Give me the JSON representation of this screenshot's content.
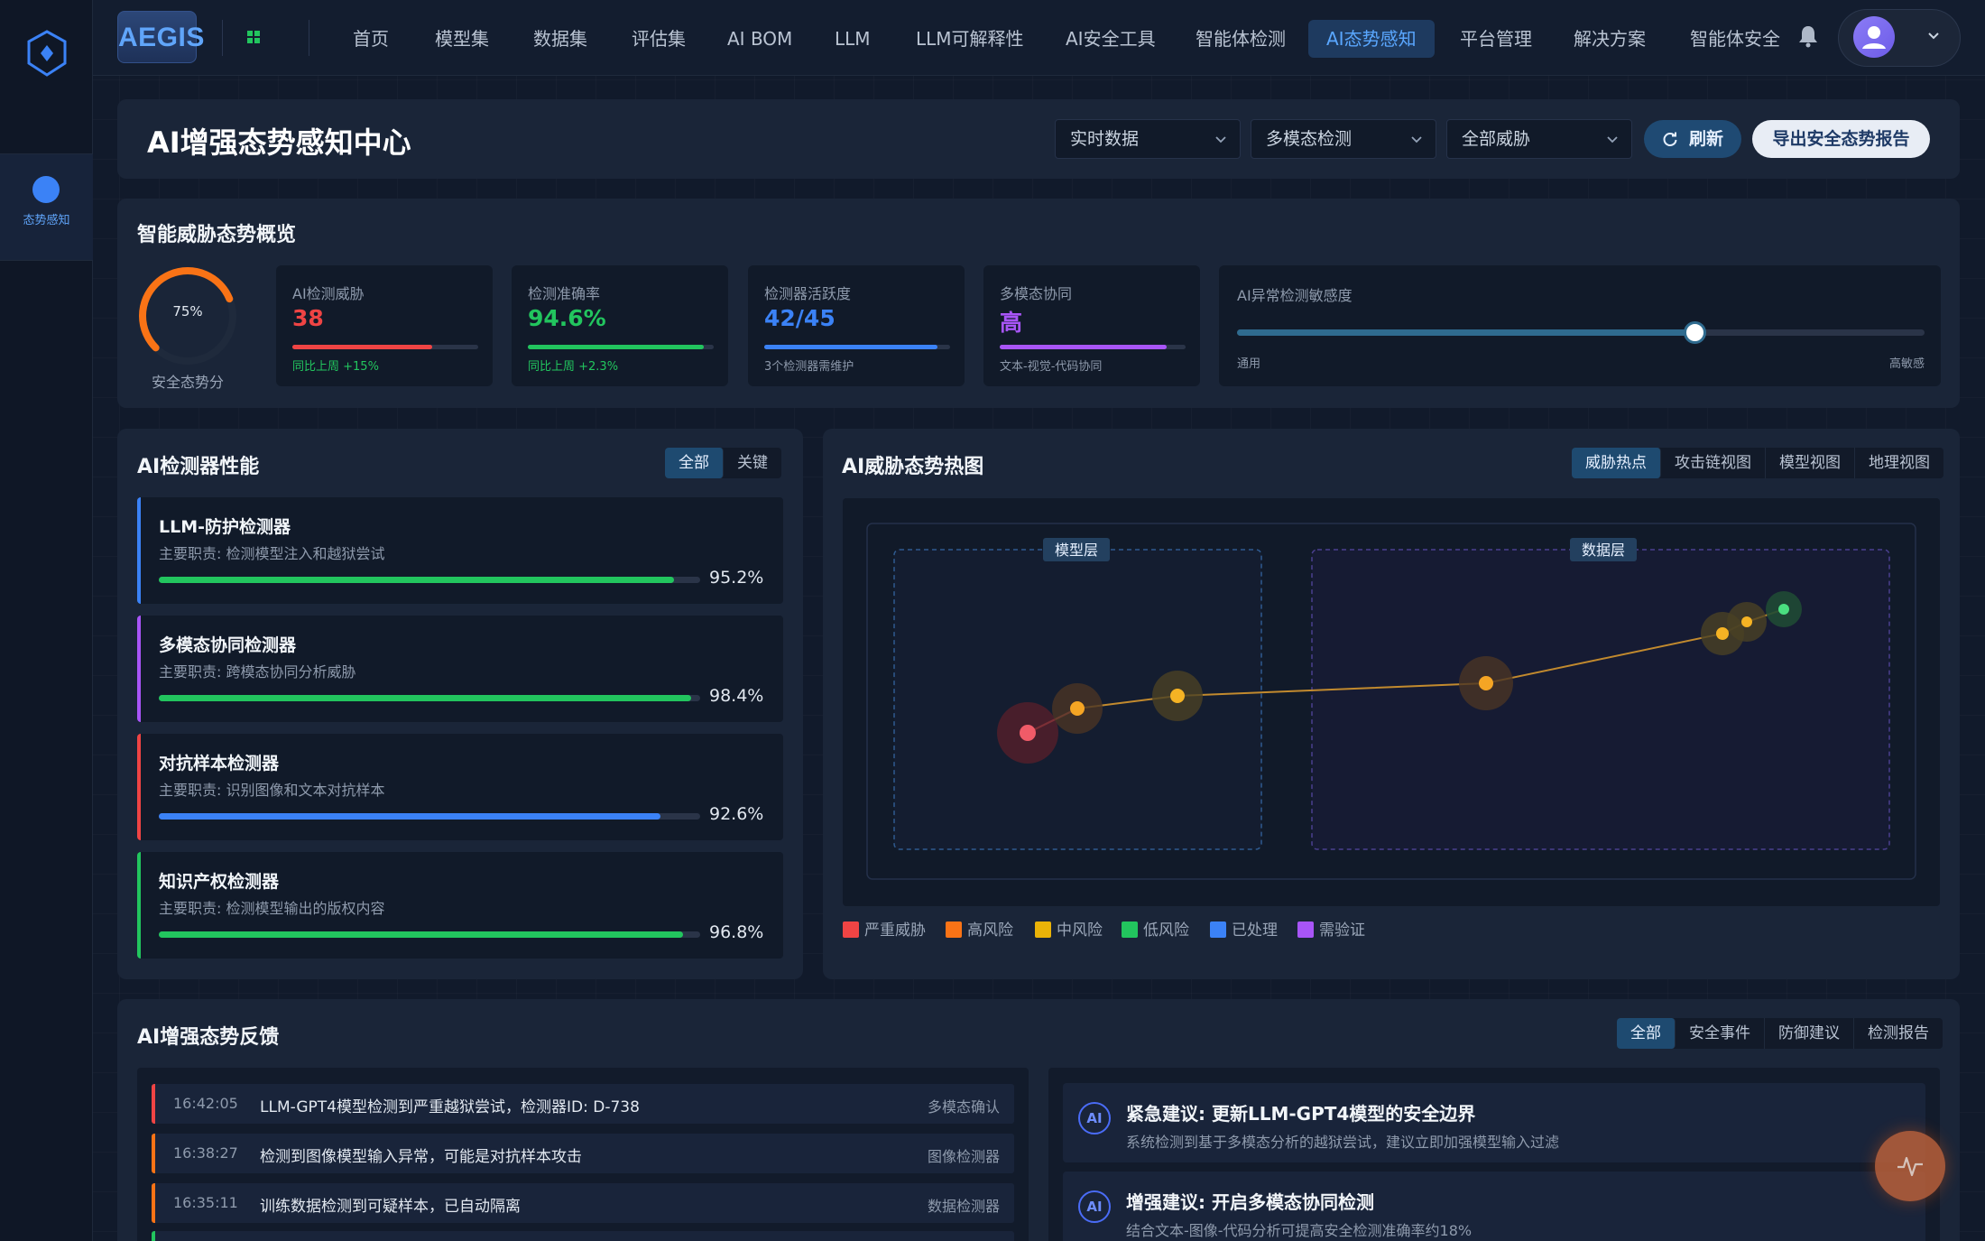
{
  "nav": {
    "brand": "AEGIS",
    "items": [
      "首页",
      "模型集",
      "数据集",
      "评估集",
      "AI BOM",
      "LLM",
      "LLM可解释性",
      "AI安全工具",
      "智能体检测",
      "AI态势感知",
      "平台管理",
      "解决方案",
      "智能体安全"
    ],
    "active": "AI态势感知"
  },
  "sidebar": {
    "item_label": "态势感知"
  },
  "header": {
    "title": "AI增强态势感知中心",
    "filters": [
      "实时数据",
      "多模态检测",
      "全部威胁"
    ],
    "refresh_label": "刷新",
    "export_label": "导出安全态势报告"
  },
  "overview": {
    "title": "智能威胁态势概览",
    "score_value": "75%",
    "score_fraction": 0.75,
    "score_label": "安全态势分",
    "metrics": [
      {
        "title": "AI检测威胁",
        "value": "38",
        "sub": "同比上周 +15%",
        "fill": 0.75,
        "color": "#ef4444",
        "sub_color": "#22c55e"
      },
      {
        "title": "检测准确率",
        "value": "94.6%",
        "sub": "同比上周 +2.3%",
        "fill": 0.946,
        "color": "#22c55e",
        "sub_color": "#22c55e"
      },
      {
        "title": "检测器活跃度",
        "value": "42/45",
        "sub": "3个检测器需维护",
        "fill": 0.933,
        "color": "#3b82f6",
        "sub_color": "#8e9aac"
      },
      {
        "title": "多模态协同",
        "value": "高",
        "sub": "文本-视觉-代码协同",
        "fill": 0.9,
        "color": "#a855f7",
        "sub_color": "#8e9aac"
      }
    ],
    "sensitivity": {
      "title": "AI异常检测敏感度",
      "low": "通用",
      "high": "高敏感",
      "fraction": 0.665
    }
  },
  "detectors": {
    "title": "AI检测器性能",
    "tabs": [
      "全部",
      "关键"
    ],
    "items": [
      {
        "name": "LLM-防护检测器",
        "duty": "主要职责: 检测模型注入和越狱尝试",
        "percent": "95.2%",
        "fraction": 0.952,
        "accent": "#3b82f6",
        "bar": "#22c55e"
      },
      {
        "name": "多模态协同检测器",
        "duty": "主要职责: 跨模态协同分析威胁",
        "percent": "98.4%",
        "fraction": 0.984,
        "accent": "#a855f7",
        "bar": "#22c55e"
      },
      {
        "name": "对抗样本检测器",
        "duty": "主要职责: 识别图像和文本对抗样本",
        "percent": "92.6%",
        "fraction": 0.926,
        "accent": "#ef4444",
        "bar": "#3b82f6"
      },
      {
        "name": "知识产权检测器",
        "duty": "主要职责: 检测模型输出的版权内容",
        "percent": "96.8%",
        "fraction": 0.968,
        "accent": "#22c55e",
        "bar": "#22c55e"
      }
    ]
  },
  "heatmap": {
    "title": "AI威胁态势热图",
    "tabs": [
      "威胁热点",
      "攻击链视图",
      "模型视图",
      "地理视图"
    ],
    "zones": [
      "模型层",
      "数据层"
    ],
    "legend": [
      {
        "label": "严重威胁",
        "color": "#ef4444"
      },
      {
        "label": "高风险",
        "color": "#f97316"
      },
      {
        "label": "中风险",
        "color": "#eab308"
      },
      {
        "label": "低风险",
        "color": "#22c55e"
      },
      {
        "label": "已处理",
        "color": "#3b82f6"
      },
      {
        "label": "需验证",
        "color": "#a855f7"
      }
    ]
  },
  "feedback": {
    "title": "AI增强态势反馈",
    "tabs": [
      "全部",
      "安全事件",
      "防御建议",
      "检测报告"
    ],
    "events": [
      {
        "time": "16:42:05",
        "text": "LLM-GPT4模型检测到严重越狱尝试，检测器ID: D-738",
        "source": "多模态确认",
        "color": "#ef4444"
      },
      {
        "time": "16:38:27",
        "text": "检测到图像模型输入异常，可能是对抗样本攻击",
        "source": "图像检测器",
        "color": "#f97316"
      },
      {
        "time": "16:35:11",
        "text": "训练数据检测到可疑样本，已自动隔离",
        "source": "数据检测器",
        "color": "#f97316"
      }
    ],
    "suggestions": [
      {
        "badge": "AI",
        "title": "紧急建议: 更新LLM-GPT4模型的安全边界",
        "desc": "系统检测到基于多模态分析的越狱尝试，建议立即加强模型输入过滤"
      },
      {
        "badge": "AI",
        "title": "增强建议: 开启多模态协同检测",
        "desc": "结合文本-图像-代码分析可提高安全检测准确率约18%"
      }
    ]
  }
}
